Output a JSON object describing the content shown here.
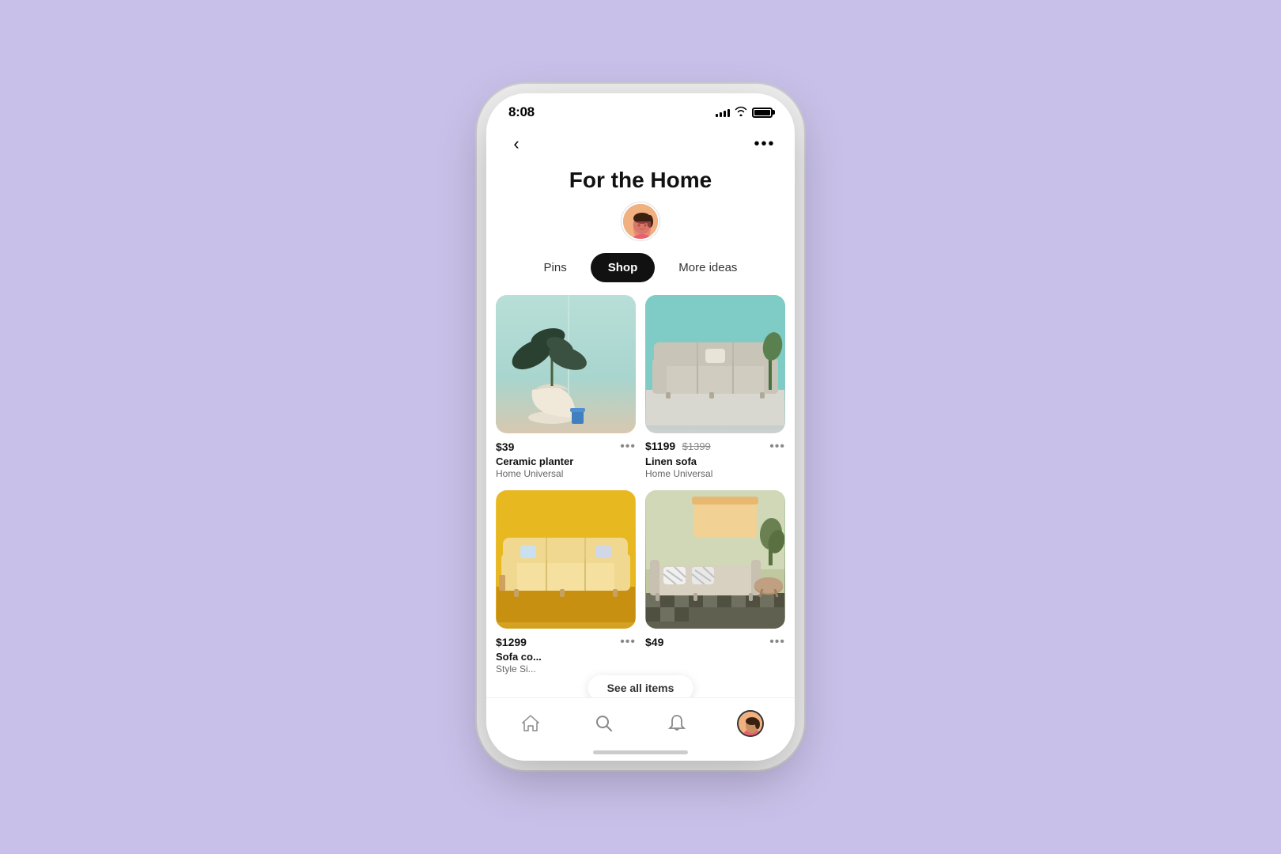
{
  "statusBar": {
    "time": "8:08",
    "signalBars": [
      4,
      6,
      8,
      10,
      12
    ],
    "wifiLabel": "wifi",
    "batteryLabel": "battery"
  },
  "nav": {
    "backLabel": "‹",
    "moreLabel": "•••"
  },
  "board": {
    "title": "For the Home",
    "avatarAlt": "User avatar"
  },
  "tabs": [
    {
      "id": "pins",
      "label": "Pins",
      "active": false
    },
    {
      "id": "shop",
      "label": "Shop",
      "active": true
    },
    {
      "id": "more-ideas",
      "label": "More ideas",
      "active": false
    }
  ],
  "products": [
    {
      "id": "product-1",
      "price": "$39",
      "priceOriginal": "",
      "name": "Ceramic planter",
      "brand": "Home Universal",
      "imageType": "planter"
    },
    {
      "id": "product-2",
      "price": "$1199",
      "priceOriginal": "$1399",
      "name": "Linen sofa",
      "brand": "Home Universal",
      "imageType": "sofa-white"
    },
    {
      "id": "product-3",
      "price": "$1299",
      "priceOriginal": "",
      "name": "Sofa co...",
      "brand": "Style Si...",
      "imageType": "sofa-yellow"
    },
    {
      "id": "product-4",
      "price": "$49",
      "priceOriginal": "",
      "name": "",
      "brand": "",
      "imageType": "outdoor"
    }
  ],
  "bottomNav": {
    "home": "⌂",
    "search": "⌕",
    "bell": "🔔",
    "profileAlt": "Profile avatar"
  },
  "seeAllLabel": "See all items"
}
